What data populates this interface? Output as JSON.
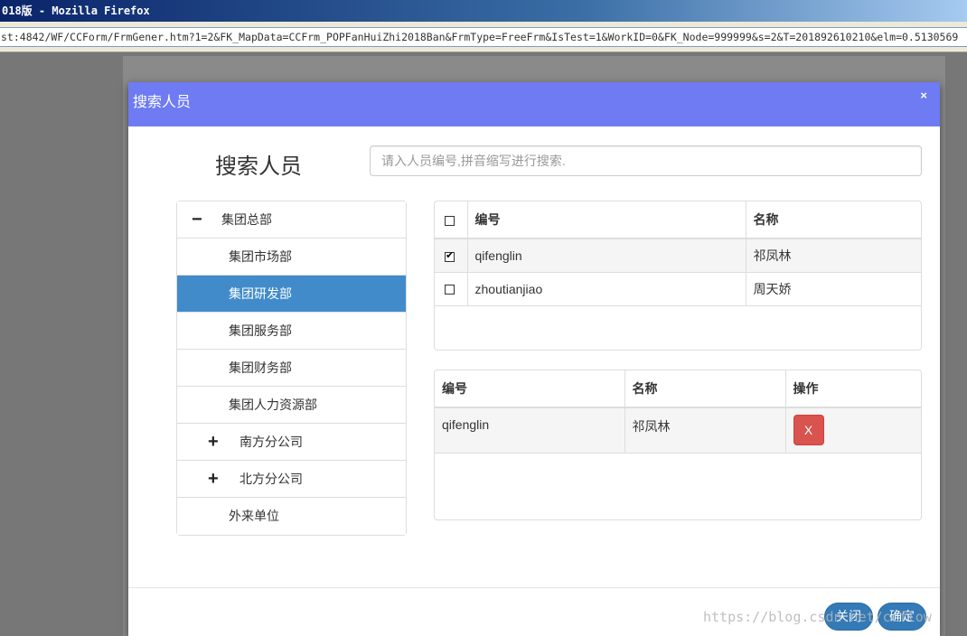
{
  "window": {
    "title": "018版 - Mozilla Firefox",
    "url": "st:4842/WF/CCForm/FrmGener.htm?1=2&FK_MapData=CCFrm_POPFanHuiZhi2018Ban&FrmType=FreeFrm&IsTest=1&WorkID=0&FK_Node=999999&s=2&T=201892610210&elm=0.5130569"
  },
  "modal": {
    "title": "搜索人员",
    "close": "×",
    "heading": "搜索人员",
    "search_placeholder": "请入人员编号,拼音缩写进行搜索."
  },
  "tree": [
    {
      "toggle": "−",
      "label": "集团总部",
      "level": 0,
      "active": false
    },
    {
      "toggle": "",
      "label": "集团市场部",
      "level": 1,
      "active": false
    },
    {
      "toggle": "",
      "label": "集团研发部",
      "level": 1,
      "active": true
    },
    {
      "toggle": "",
      "label": "集团服务部",
      "level": 1,
      "active": false
    },
    {
      "toggle": "",
      "label": "集团财务部",
      "level": 1,
      "active": false
    },
    {
      "toggle": "",
      "label": "集团人力资源部",
      "level": 1,
      "active": false
    },
    {
      "toggle": "+",
      "label": "南方分公司",
      "level": 1,
      "active": false
    },
    {
      "toggle": "+",
      "label": "北方分公司",
      "level": 1,
      "active": false
    },
    {
      "toggle": "",
      "label": "外来单位",
      "level": 1,
      "active": false
    }
  ],
  "candidates": {
    "headers": {
      "id": "编号",
      "name": "名称"
    },
    "rows": [
      {
        "checked": true,
        "id": "qifenglin",
        "name": "祁凤林"
      },
      {
        "checked": false,
        "id": "zhoutianjiao",
        "name": "周天娇"
      }
    ]
  },
  "selected": {
    "headers": {
      "id": "编号",
      "name": "名称",
      "action": "操作"
    },
    "rows": [
      {
        "id": "qifenglin",
        "name": "祁凤林",
        "remove": "X"
      }
    ]
  },
  "footer": {
    "close": "关闭",
    "confirm": "确定"
  },
  "watermark": "https://blog.csdn.net/ccflow"
}
